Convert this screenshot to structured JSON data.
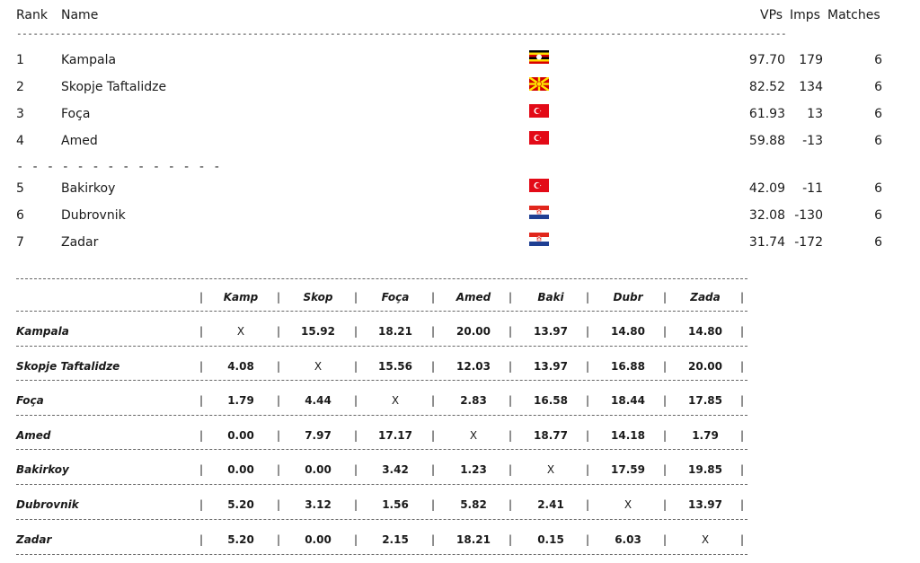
{
  "ranking": {
    "headers": {
      "rank": "Rank",
      "name": "Name",
      "vps": "VPs",
      "imps": "Imps",
      "matches": "Matches"
    },
    "separator_top": "--------------------------------------------------------------------------------------------------------------------------------------------------------------",
    "separator_mid": "- - - - - - - - - - - - - -",
    "rows": [
      {
        "rank": "1",
        "name": "Kampala",
        "flag": "uganda",
        "vps": "97.70",
        "imps": "179",
        "matches": "6"
      },
      {
        "rank": "2",
        "name": "Skopje Taftalidze",
        "flag": "north-macedonia",
        "vps": "82.52",
        "imps": "134",
        "matches": "6"
      },
      {
        "rank": "3",
        "name": "Foça",
        "flag": "turkey",
        "vps": "61.93",
        "imps": "13",
        "matches": "6"
      },
      {
        "rank": "4",
        "name": "Amed",
        "flag": "turkey",
        "vps": "59.88",
        "imps": "-13",
        "matches": "6"
      },
      {
        "rank": "5",
        "name": "Bakirkoy",
        "flag": "turkey",
        "vps": "42.09",
        "imps": "-11",
        "matches": "6"
      },
      {
        "rank": "6",
        "name": "Dubrovnik",
        "flag": "croatia",
        "vps": "32.08",
        "imps": "-130",
        "matches": "6"
      },
      {
        "rank": "7",
        "name": "Zadar",
        "flag": "croatia",
        "vps": "31.74",
        "imps": "-172",
        "matches": "6"
      }
    ]
  },
  "cross_table": {
    "columns": [
      "Kamp",
      "Skop",
      "Foça",
      "Amed",
      "Baki",
      "Dubr",
      "Zada"
    ],
    "bar": "|",
    "rows": [
      {
        "name": "Kampala",
        "cells": [
          "X",
          "15.92",
          "18.21",
          "20.00",
          "13.97",
          "14.80",
          "14.80"
        ]
      },
      {
        "name": "Skopje Taftalidze",
        "cells": [
          "4.08",
          "X",
          "15.56",
          "12.03",
          "13.97",
          "16.88",
          "20.00"
        ]
      },
      {
        "name": "Foça",
        "cells": [
          "1.79",
          "4.44",
          "X",
          "2.83",
          "16.58",
          "18.44",
          "17.85"
        ]
      },
      {
        "name": "Amed",
        "cells": [
          "0.00",
          "7.97",
          "17.17",
          "X",
          "18.77",
          "14.18",
          "1.79"
        ]
      },
      {
        "name": "Bakirkoy",
        "cells": [
          "0.00",
          "0.00",
          "3.42",
          "1.23",
          "X",
          "17.59",
          "19.85"
        ]
      },
      {
        "name": "Dubrovnik",
        "cells": [
          "5.20",
          "3.12",
          "1.56",
          "5.82",
          "2.41",
          "X",
          "13.97"
        ]
      },
      {
        "name": "Zadar",
        "cells": [
          "5.20",
          "0.00",
          "2.15",
          "18.21",
          "0.15",
          "6.03",
          "X"
        ]
      }
    ]
  }
}
